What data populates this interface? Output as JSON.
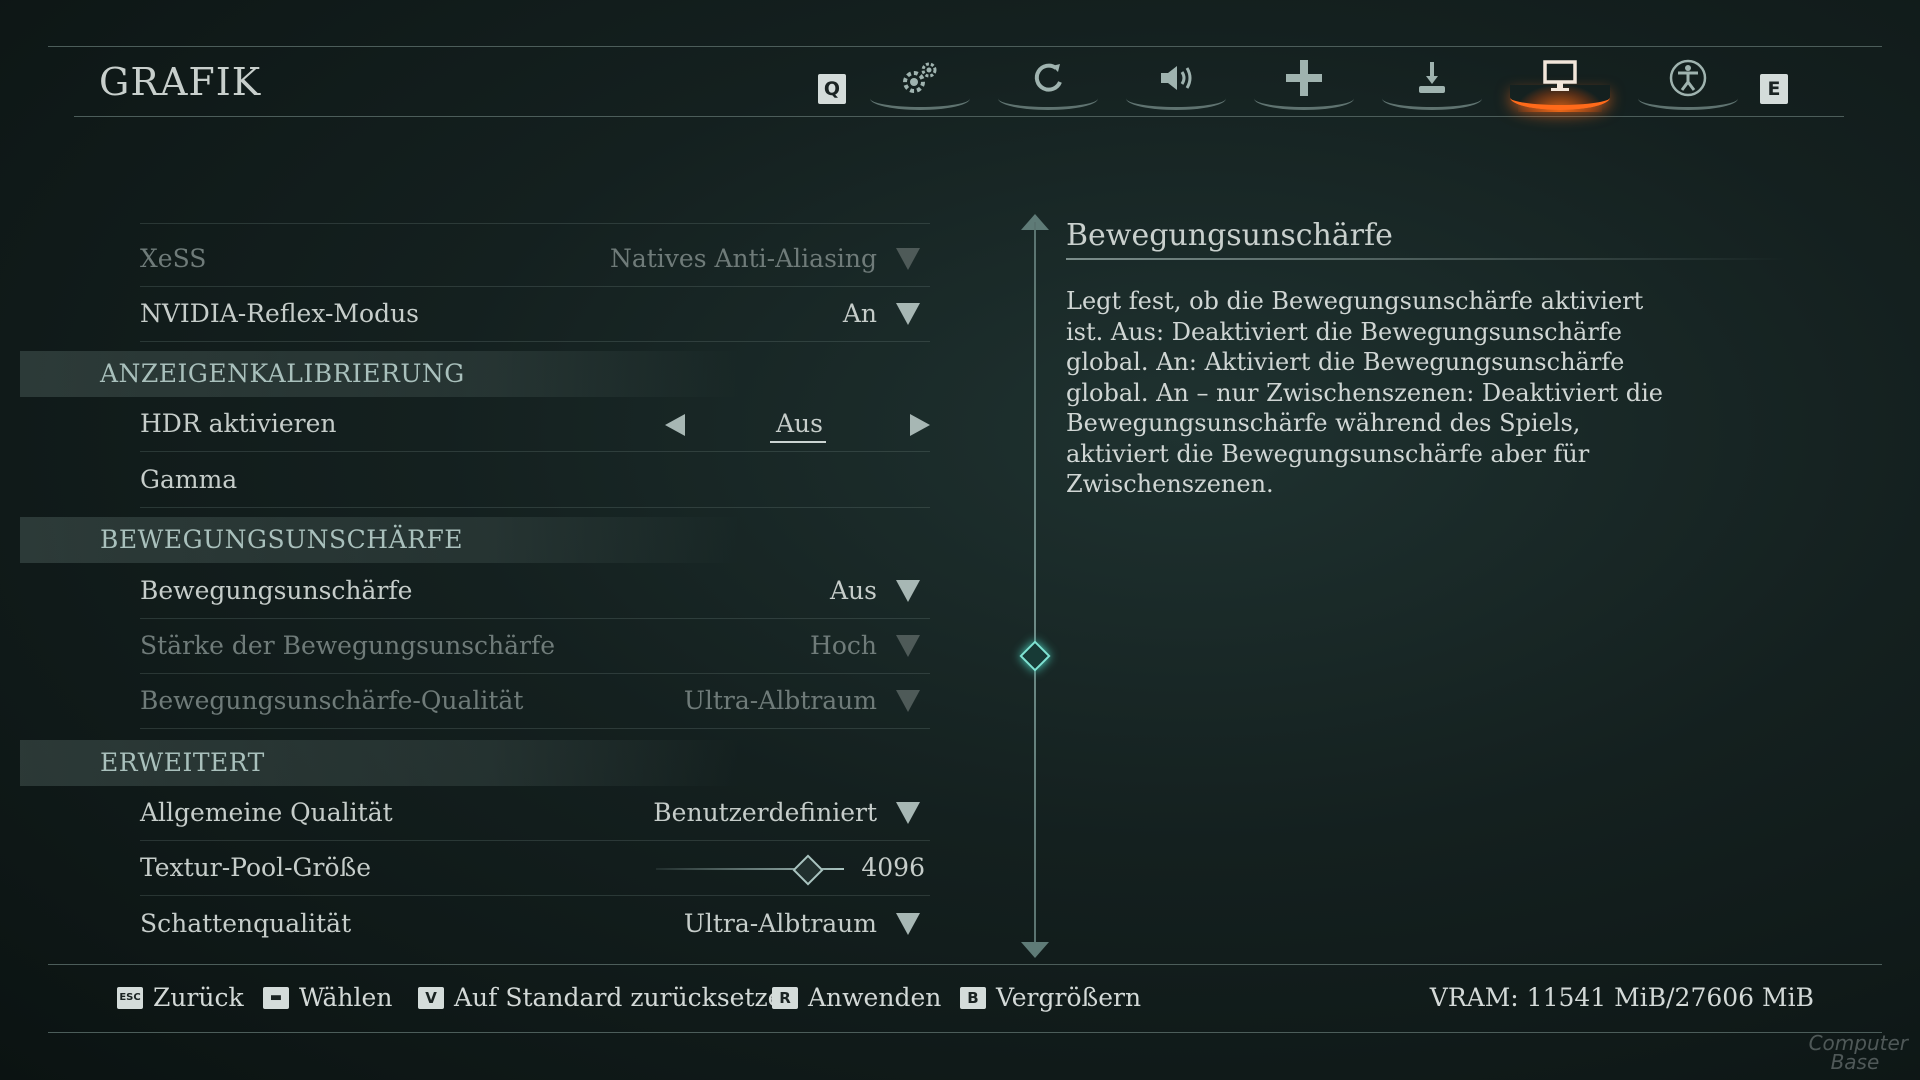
{
  "page": {
    "title": "GRAFIK"
  },
  "tabs": {
    "prev_key": "Q",
    "next_key": "E",
    "items": [
      {
        "icon": "gears-icon",
        "active": false
      },
      {
        "icon": "swirl-icon",
        "active": false
      },
      {
        "icon": "speaker-icon",
        "active": false
      },
      {
        "icon": "dpad-icon",
        "active": false
      },
      {
        "icon": "joystick-icon",
        "active": false
      },
      {
        "icon": "monitor-icon",
        "active": true
      },
      {
        "icon": "accessibility-icon",
        "active": false
      }
    ]
  },
  "settings": {
    "xess": {
      "label": "XeSS",
      "value": "Natives Anti-Aliasing",
      "disabled": true
    },
    "reflex": {
      "label": "NVIDIA-Reflex-Modus",
      "value": "An"
    },
    "section_calibration": "ANZEIGENKALIBRIERUNG",
    "hdr": {
      "label": "HDR aktivieren",
      "value": "Aus"
    },
    "gamma": {
      "label": "Gamma"
    },
    "section_motion": "BEWEGUNGSUNSCHÄRFE",
    "motion_blur": {
      "label": "Bewegungsunschärfe",
      "value": "Aus"
    },
    "motion_strength": {
      "label": "Stärke der Bewegungsunschärfe",
      "value": "Hoch",
      "disabled": true
    },
    "motion_quality": {
      "label": "Bewegungsunschärfe-Qualität",
      "value": "Ultra-Albtraum",
      "disabled": true
    },
    "section_advanced": "ERWEITERT",
    "overall_quality": {
      "label": "Allgemeine Qualität",
      "value": "Benutzerdefiniert"
    },
    "texture_pool": {
      "label": "Textur-Pool-Größe",
      "value": "4096",
      "fill": 0.8
    },
    "shadow_quality": {
      "label": "Schattenqualität",
      "value": "Ultra-Albtraum"
    }
  },
  "description": {
    "title": "Bewegungsunschärfe",
    "text": "Legt fest, ob die Bewegungsunschärfe aktiviert ist. Aus: Deaktiviert die Bewegungsunschärfe global. An: Aktiviert die Bewegungsunschärfe global. An – nur Zwischenszenen: Deaktiviert die Bewegungsunschärfe während des Spiels, aktiviert die Bewegungsunschärfe aber für Zwischenszenen."
  },
  "footer": {
    "back": {
      "key": "ESC",
      "label": "Zurück"
    },
    "select": {
      "key": "▬",
      "label": "Wählen"
    },
    "reset": {
      "key": "V",
      "label": "Auf Standard zurücksetzen"
    },
    "apply": {
      "key": "R",
      "label": "Anwenden"
    },
    "zoom": {
      "key": "B",
      "label": "Vergrößern"
    },
    "vram": "VRAM: 11541 MiB/27606 MiB"
  },
  "watermark": {
    "line1": "Computer",
    "line2": "Base"
  },
  "colors": {
    "accent_active": "#ff6a1a",
    "text": "#c6cdca",
    "section": "#a9c0bc"
  }
}
